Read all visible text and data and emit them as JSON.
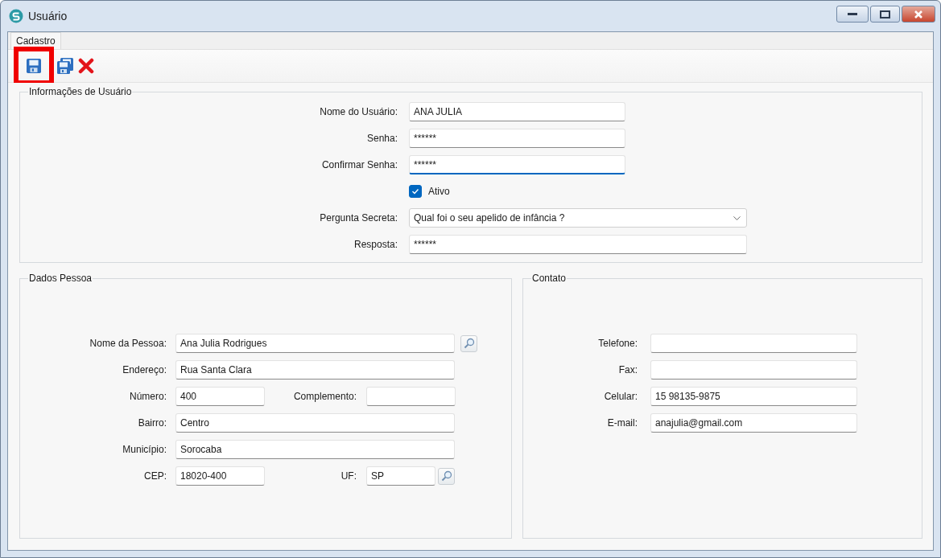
{
  "window": {
    "title": "Usuário"
  },
  "tabs": [
    {
      "label": "Cadastro",
      "selected": true
    }
  ],
  "toolbar": [
    {
      "kind": "save",
      "highlighted": true
    },
    {
      "kind": "save_all",
      "highlighted": false
    },
    {
      "kind": "delete",
      "highlighted": false
    }
  ],
  "user_info": {
    "title": "Informações de Usuário",
    "fields": [
      {
        "kind": "text",
        "label": "Nome do Usuário:",
        "value": "ANA JULIA",
        "focused": false
      },
      {
        "kind": "text",
        "label": "Senha:",
        "value": "******",
        "focused": false
      },
      {
        "kind": "text",
        "label": "Confirmar Senha:",
        "value": "******",
        "focused": true
      },
      {
        "kind": "checkbox",
        "label": "Ativo",
        "checked": true
      },
      {
        "kind": "select",
        "label": "Pergunta Secreta:",
        "value": "Qual foi o seu apelido de infância ?"
      },
      {
        "kind": "wide",
        "label": "Resposta:",
        "value": "******",
        "focused": false
      }
    ]
  },
  "person": {
    "title": "Dados Pessoa",
    "rows": [
      {
        "fields": [
          {
            "label": "Nome da Pessoa:",
            "value": "Ana Julia Rodrigues",
            "lookup": true
          }
        ]
      },
      {
        "fields": [
          {
            "label": "Endereço:",
            "value": "Rua Santa Clara",
            "lookup": false
          }
        ]
      },
      {
        "fields": [
          {
            "label": "Número:",
            "value": "400",
            "lookup": false
          },
          {
            "label": "Complemento:",
            "lookup": false
          }
        ]
      },
      {
        "fields": [
          {
            "label": "Bairro:",
            "value": "Centro",
            "lookup": false
          }
        ]
      },
      {
        "fields": [
          {
            "label": "Município:",
            "value": "Sorocaba",
            "lookup": false
          }
        ]
      },
      {
        "fields": [
          {
            "label": "CEP:",
            "value": "18020-400",
            "lookup": false
          },
          {
            "label": "UF:",
            "value": "SP",
            "lookup": true
          }
        ]
      }
    ]
  },
  "contact": {
    "title": "Contato",
    "fields": [
      {
        "label": "Telefone:"
      },
      {
        "label": "Fax:"
      },
      {
        "label": "Celular:",
        "value": "15 98135-9875"
      },
      {
        "label": "E-mail:",
        "value": "anajulia@gmail.com"
      }
    ]
  }
}
